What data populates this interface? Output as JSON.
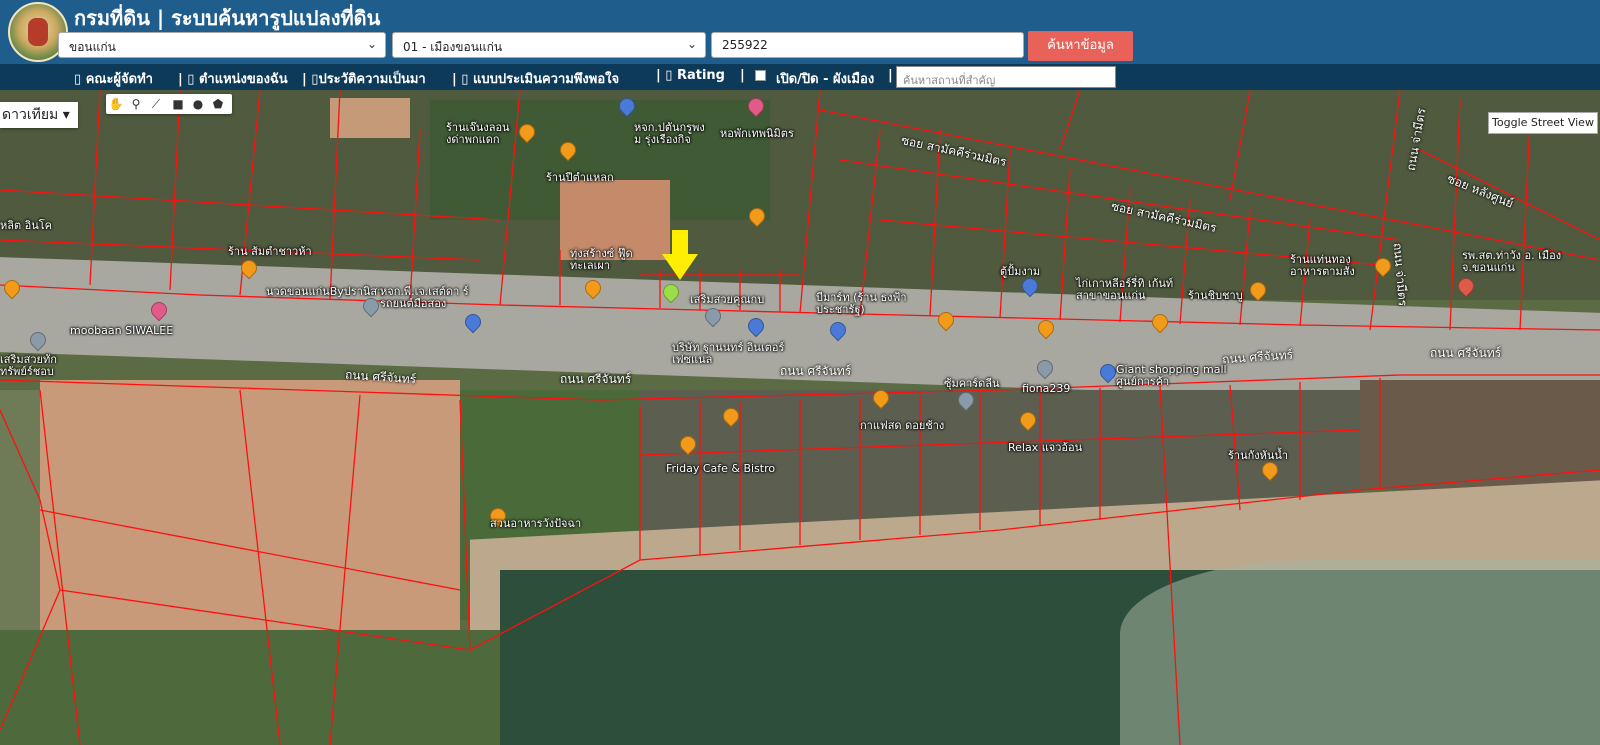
{
  "header": {
    "title": "กรมที่ดิน | ระบบค้นหารูปแปลงที่ดิน",
    "province": "ขอนแก่น",
    "district": "01 - เมืองขอนแก่น",
    "parcel_number": "255922",
    "search_label": "ค้นหาข้อมูล"
  },
  "nav": {
    "items": [
      "คณะผู้จัดทำ",
      "ตำแหน่งของฉัน",
      "ประวัติความเป็นมา",
      "แบบประเมินความพึงพอใจ",
      "Rating"
    ],
    "toggle_label": "เปิด/ปิด - ผังเมือง",
    "place_placeholder": "ค้นหาสถานที่สำคัญ"
  },
  "map": {
    "basemap_label": "ดาวเทียม",
    "street_view_label": "Toggle Street View",
    "roads": [
      "ถนน ศรีจันทร์",
      "ถนน ศรีจันทร์",
      "ถนน ศรีจันทร์",
      "ถนน ศรีจันทร์",
      "ถนน ศรีจันทร์",
      "ซอย สามัคคีร่วมมิตร",
      "ซอย สามัคคีร่วมมิตร",
      "ซอย หลังศูนย์",
      "ถนน จ่ามีตร",
      "ถนน จ่ามีตร"
    ],
    "places": [
      "ร้านเจ๊นงลอน งด่าพกแดก",
      "หจก.ปตันกรูพง ม รุ่งเรืองกิจ",
      "หอพักเทพนิมิตร",
      "ร้านปีตำแหลก",
      "ร้าน ส้มตำชาวห้า",
      "ทุ่งสร้างซ์ ฟู๊ด ทะเลเผา",
      "นวดขอนแก่นByปรานิสา",
      "หจก.พี.เจ.เสต์ดา ร์ รถยนต์มือสอง",
      "เสริมสวยคุณกบ",
      "บีมาร์ท (ร้าน ธงฟ้าประชารัฐ)",
      "ตู้ปั้มงาม",
      "ไก่เกาหลีอร์รี่ทิ เก้นท์ สาขาขอนแก่น",
      "ร้านชิบชาบู",
      "ร้านแท่นทอง อาหารตามสั่ง",
      "รพ.สต.ท่าวัง อ. เมือง จ.ขอนแก่น",
      "moobaan SIWALEE",
      "เสริมสวยทัก ทรัพย์ร์ชอบ",
      "บริษัท ฐานนทร์ อินเตอร์ เฟซแนล",
      "ซุ้มคาร์ดลีน",
      "fiona239",
      "Giant shopping mall ศูนย์การค้า",
      "กาแฟสด ดอยช้าง",
      "Friday Cafe & Bistro",
      "Relax แจวอ้อน",
      "ร้านกังหันน้ำ",
      "สวนอาหารวังปัจฉา",
      "หลิต อินโค"
    ]
  }
}
